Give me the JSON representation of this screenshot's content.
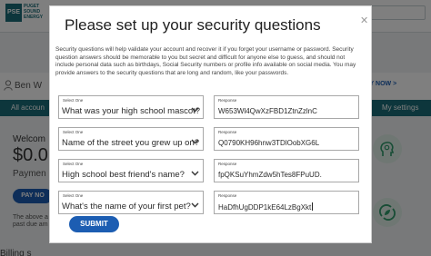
{
  "background": {
    "logo": {
      "abbr": "PSE",
      "name_line1": "PUGET",
      "name_line2": "SOUND",
      "name_line3": "ENERGY"
    },
    "account_name": "Ben W",
    "pay_now_top": "PAY NOW >",
    "bar_left": "All accoun",
    "bar_right": "My settings",
    "welcome": "Welcom",
    "amount": "$0.0",
    "payment": "Paymen",
    "pay_button": "PAY NO",
    "above_text": "The above a",
    "past_due_text": "past due am",
    "billing_heading": "Billing s",
    "accent_color": "#1a6d78",
    "button_color": "#1c5db2"
  },
  "modal": {
    "title": "Please set up your security questions",
    "close_icon": "x-icon",
    "description": "Security questions will help validate your account and recover it if you forget your username or password. Security question answers should be memorable to you but secret and difficult for anyone else to guess, and should not include personal data such as birthdays, Social Security numbers or profile info available on social media. You may provide answers to the security questions that are long and random, like your passwords.",
    "questions": [
      {
        "select_label": "Select One",
        "question": "What was your high school mascot?",
        "response_label": "Response",
        "response": "W653Wl4QwXzFBD1ZtnZzlnC"
      },
      {
        "select_label": "Select One",
        "question": "Name of the street you grew up on?",
        "response_label": "Response",
        "response": "Q0790KH96hnw3TDlOobXG6L"
      },
      {
        "select_label": "Select One",
        "question": "High school best friend's name?",
        "response_label": "Response",
        "response": "fpQKSuYhmZdw5hTes8FPuUD."
      },
      {
        "select_label": "Select One",
        "question": "What's the name of your first pet?",
        "response_label": "Response",
        "response": "HaDfhUgDDP1kE64LzBgXkt"
      }
    ],
    "submit_label": "SUBMIT"
  }
}
